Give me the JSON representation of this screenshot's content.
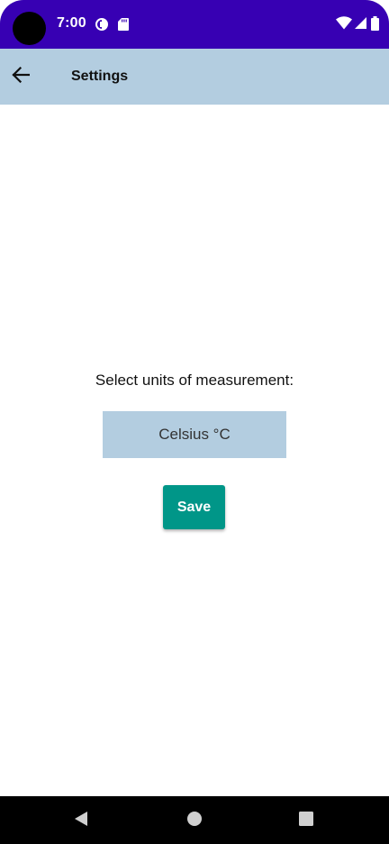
{
  "status_bar": {
    "time": "7:00",
    "background_color": "#3700b3",
    "notification_icons": [
      "data-saver-icon",
      "sd-card-icon"
    ],
    "system_icons": [
      "wifi-icon",
      "cell-signal-icon",
      "battery-icon"
    ]
  },
  "app_bar": {
    "title": "Settings",
    "back_icon": "arrow-back-icon",
    "background_color": "#b3cde0"
  },
  "settings": {
    "prompt": "Select units of measurement:",
    "selected_unit": "Celsius °C",
    "save_label": "Save",
    "save_color": "#009688"
  },
  "nav_bar": {
    "icons": [
      "nav-back-icon",
      "nav-home-icon",
      "nav-recents-icon"
    ]
  }
}
